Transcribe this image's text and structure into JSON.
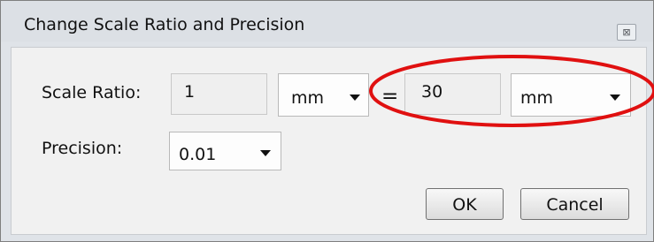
{
  "window": {
    "title": "Change Scale Ratio and Precision",
    "close_glyph": "⊠"
  },
  "scale_ratio": {
    "label": "Scale Ratio:",
    "left_value": "1",
    "left_unit": "mm",
    "equals": "=",
    "right_value": "30",
    "right_unit": "mm"
  },
  "precision": {
    "label": "Precision:",
    "value": "0.01"
  },
  "buttons": {
    "ok": "OK",
    "cancel": "Cancel"
  },
  "annotation": {
    "color": "#e01010"
  }
}
